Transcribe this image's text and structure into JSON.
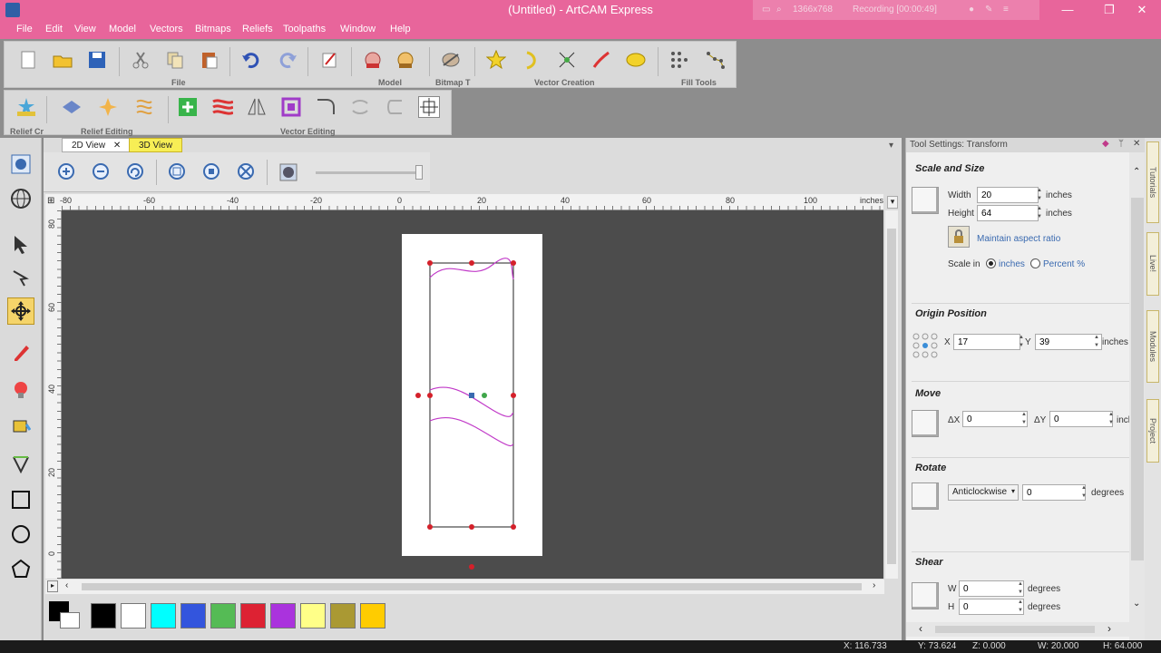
{
  "window": {
    "title": "(Untitled) - ArtCAM Express",
    "recorder": {
      "resolution": "1366x768",
      "recording": "Recording [00:00:49]"
    }
  },
  "menu": [
    "File",
    "Edit",
    "View",
    "Model",
    "Vectors",
    "Bitmaps",
    "Reliefs",
    "Toolpaths",
    "Window",
    "Help"
  ],
  "toolbar_groups": {
    "file": "File",
    "model": "Model",
    "bitmap": "Bitmap T",
    "vector_creation": "Vector Creation",
    "fill_tools": "Fill Tools",
    "relief_create": "Relief Cr",
    "relief_editing": "Relief Editing",
    "vector_editing": "Vector Editing"
  },
  "tabs": {
    "view2d": "2D View",
    "view3d": "3D View"
  },
  "ruler": {
    "units": "inches",
    "h_labels": [
      "-80",
      "-60",
      "-40",
      "-20",
      "0",
      "20",
      "40",
      "60",
      "80",
      "100"
    ],
    "v_labels": [
      "80",
      "60",
      "40",
      "20",
      "0"
    ]
  },
  "palette": {
    "colors": [
      "#000000",
      "#ffffff",
      "#00ffff",
      "#3355dd",
      "#55bb55",
      "#dd2233",
      "#aa33dd",
      "#ffff88",
      "#aa9933",
      "#ffcc00"
    ]
  },
  "panel": {
    "title": "Tool Settings: Transform",
    "scale_section": "Scale and Size",
    "width_label": "Width",
    "width_value": "20",
    "width_unit": "inches",
    "height_label": "Height",
    "height_value": "64",
    "height_unit": "inches",
    "maintain_aspect": "Maintain aspect ratio",
    "scale_in_label": "Scale in",
    "scale_in_opt1": "inches",
    "scale_in_opt2": "Percent %",
    "origin_section": "Origin Position",
    "x_label": "X",
    "x_value": "17",
    "y_label": "Y",
    "y_value": "39",
    "origin_unit": "inches",
    "move_section": "Move",
    "dx_label": "ΔX",
    "dx_value": "0",
    "dy_label": "ΔY",
    "dy_value": "0",
    "move_unit": "inch",
    "rotate_section": "Rotate",
    "rotate_dir": "Anticlockwise",
    "rotate_value": "0",
    "rotate_unit": "degrees",
    "shear_section": "Shear",
    "w_label": "W",
    "w_value": "0",
    "w_unit": "degrees",
    "h_label": "H",
    "h_value": "0",
    "h_unit": "degrees"
  },
  "side_tabs": [
    "Tutorials",
    "Live!",
    "Modules",
    "Project"
  ],
  "status": {
    "x": "X: 116.733",
    "y": "Y: 73.624",
    "z": "Z: 0.000",
    "w": "W: 20.000",
    "h": "H: 64.000"
  }
}
